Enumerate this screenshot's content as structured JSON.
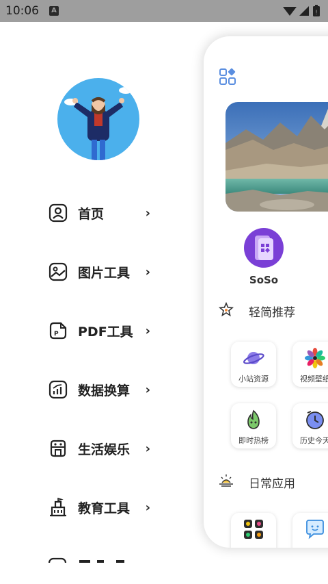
{
  "status_bar": {
    "time": "10:06",
    "badge": "A"
  },
  "menu": {
    "items": [
      {
        "label": "首页",
        "icon": "person-icon"
      },
      {
        "label": "图片工具",
        "icon": "image-icon"
      },
      {
        "label": "PDF工具",
        "icon": "pdf-icon"
      },
      {
        "label": "数据换算",
        "icon": "chart-icon"
      },
      {
        "label": "生活娱乐",
        "icon": "robot-icon"
      },
      {
        "label": "教育工具",
        "icon": "school-icon"
      }
    ],
    "chevron": "›"
  },
  "main": {
    "featured": {
      "label": "SoSo"
    },
    "section_recommend": {
      "title": "轻简推荐"
    },
    "tiles": [
      {
        "label": "小站资源",
        "icon": "planet-icon"
      },
      {
        "label": "视频壁纸",
        "icon": "flower-icon"
      },
      {
        "label": "即时热榜",
        "icon": "flame-icon"
      },
      {
        "label": "历史今天",
        "icon": "clock-icon"
      }
    ],
    "section_daily": {
      "title": "日常应用"
    },
    "tiles_bottom": [
      {
        "label": "",
        "icon": "apps-grid-icon"
      },
      {
        "label": "",
        "icon": "chat-icon"
      }
    ]
  },
  "colors": {
    "status_bar": "#9e9e9e",
    "accent_purple": "#7a3fd6",
    "avatar_bg": "#4bb0ec"
  }
}
